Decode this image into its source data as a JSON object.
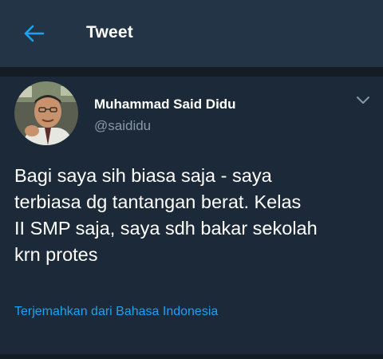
{
  "header": {
    "title": "Tweet",
    "back_icon": "back-arrow-icon"
  },
  "tweet": {
    "author_name": "Muhammad Said Didu",
    "author_handle": "@saididu",
    "avatar_icon": "user-avatar-photo",
    "menu_icon": "chevron-down-icon",
    "text": "Bagi saya sih biasa saja - saya\nterbiasa dg tantangan berat. Kelas\nII SMP saja, saya sdh bakar sekolah\nkrn protes",
    "translate_label": "Terjemahkan dari Bahasa Indonesia"
  },
  "colors": {
    "background": "#1c2938",
    "header_background": "#243447",
    "accent": "#1da1f2",
    "secondary_text": "#8899a6"
  }
}
